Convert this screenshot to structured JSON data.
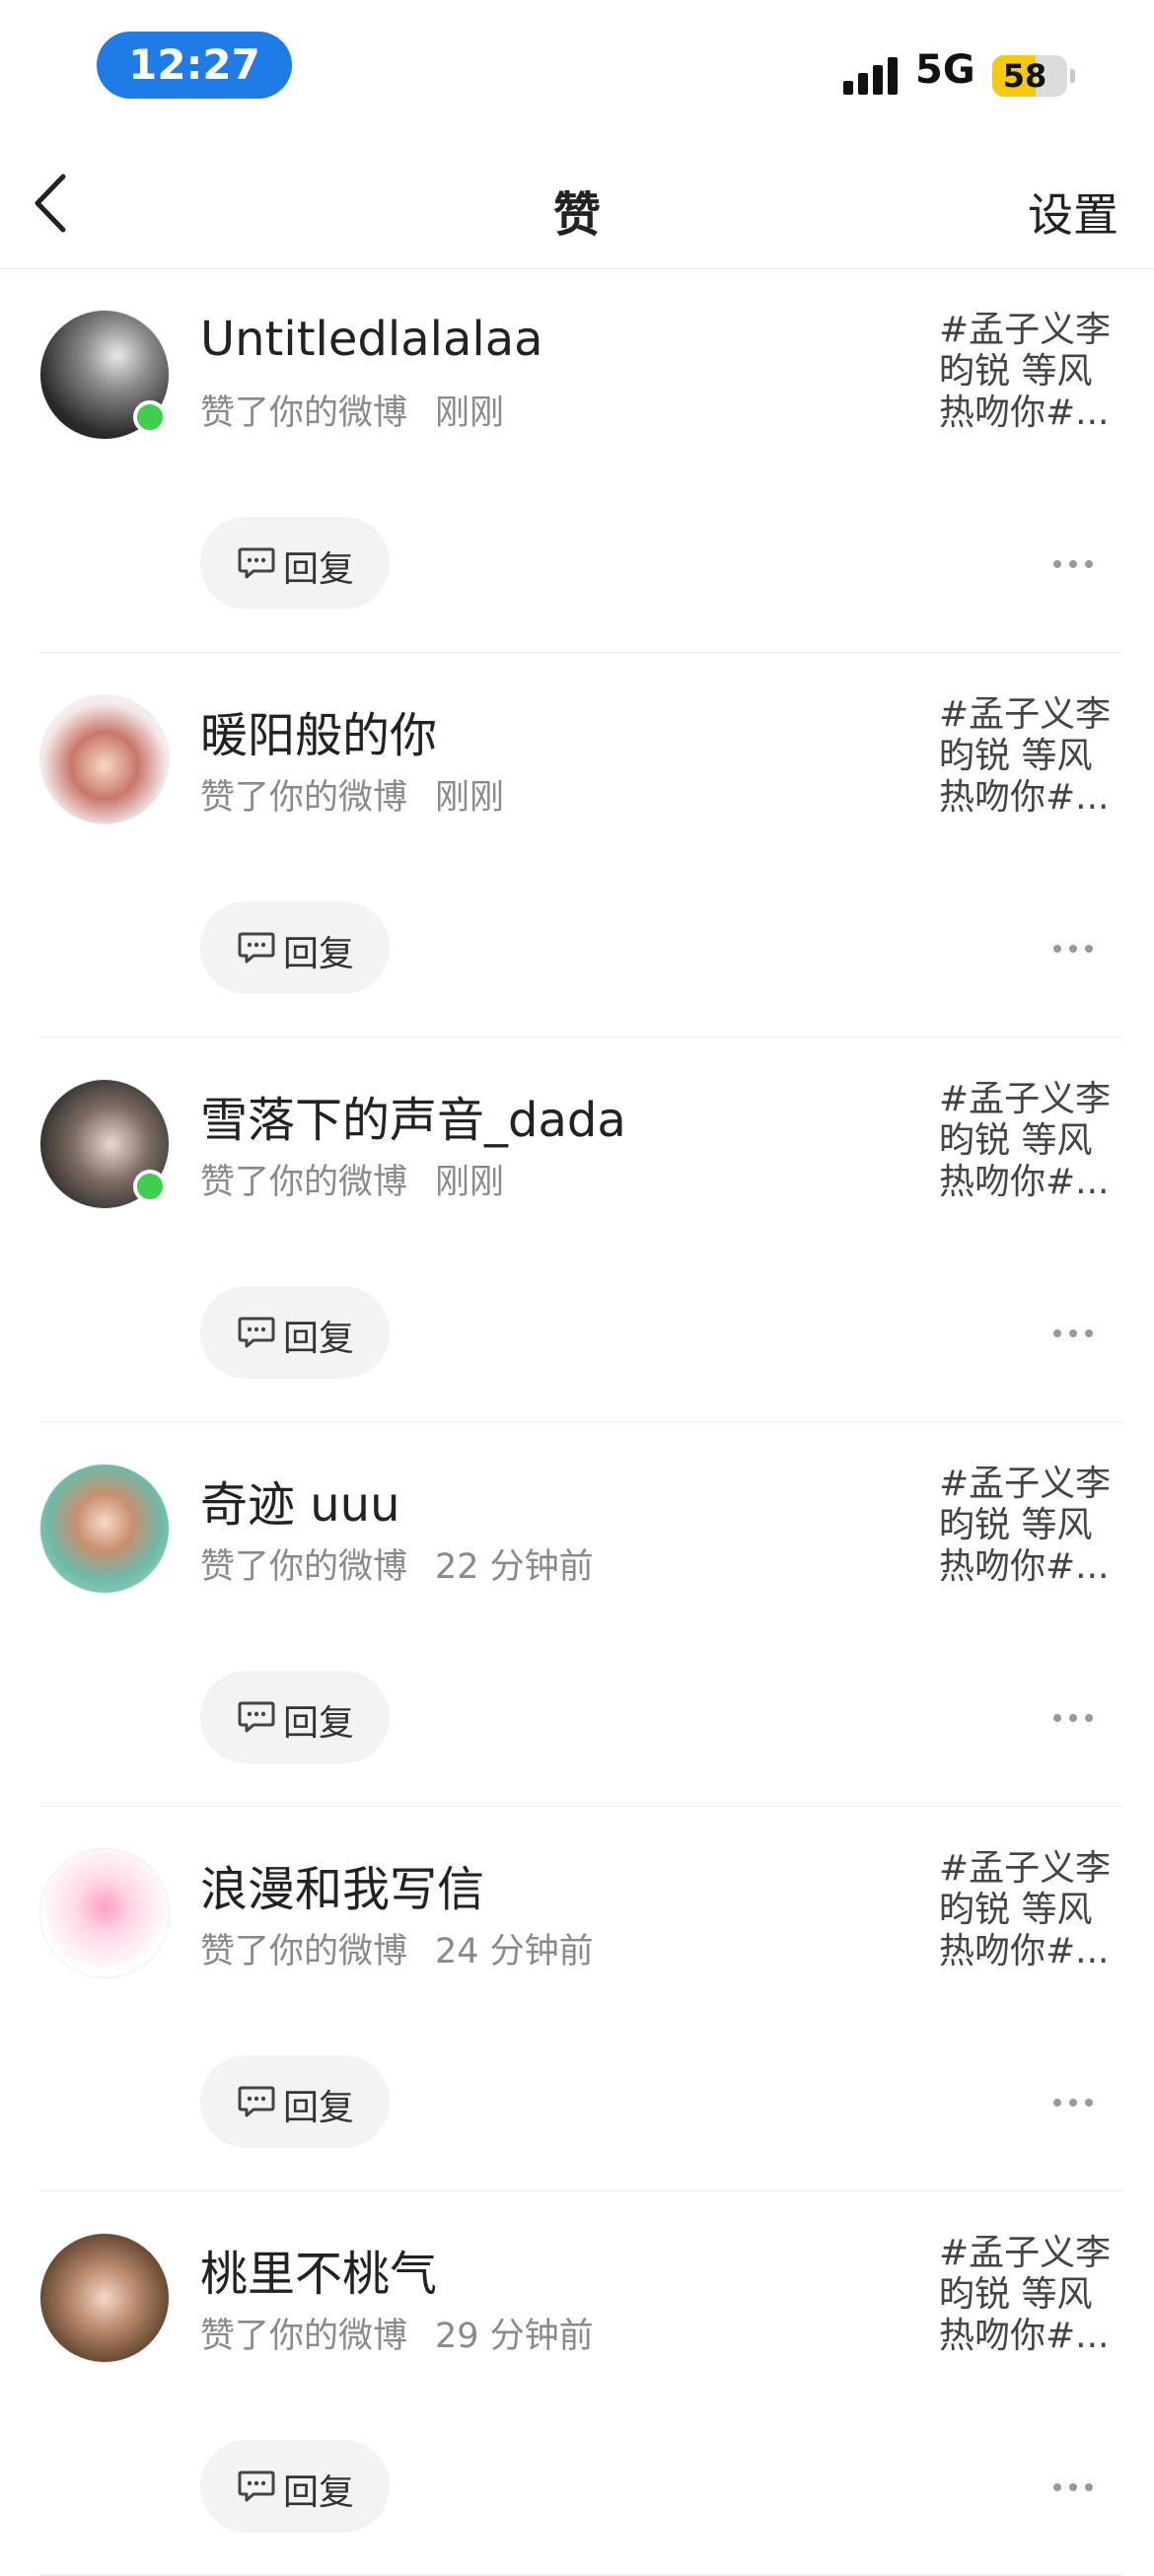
{
  "status_bar": {
    "time": "12:27",
    "network": "5G",
    "battery": "58",
    "battery_level": 0.58
  },
  "nav": {
    "back_icon": "chevron-left-icon",
    "title": "赞",
    "settings_label": "设置"
  },
  "reply_label": "回复",
  "items": [
    {
      "name": "Untitledlalalaa",
      "action": "赞了你的微博",
      "time": "刚刚",
      "online": true,
      "snippet": [
        "#孟子义李",
        "昀锐 等风",
        "热吻你#..."
      ]
    },
    {
      "name": "暖阳般的你",
      "action": "赞了你的微博",
      "time": "刚刚",
      "online": false,
      "snippet": [
        "#孟子义李",
        "昀锐 等风",
        "热吻你#..."
      ]
    },
    {
      "name": "雪落下的声音_dada",
      "action": "赞了你的微博",
      "time": "刚刚",
      "online": true,
      "snippet": [
        "#孟子义李",
        "昀锐 等风",
        "热吻你#..."
      ]
    },
    {
      "name": "奇迹 uuu",
      "action": "赞了你的微博",
      "time": "22 分钟前",
      "online": false,
      "snippet": [
        "#孟子义李",
        "昀锐 等风",
        "热吻你#..."
      ]
    },
    {
      "name": "浪漫和我写信",
      "action": "赞了你的微博",
      "time": "24 分钟前",
      "online": false,
      "snippet": [
        "#孟子义李",
        "昀锐 等风",
        "热吻你#..."
      ]
    },
    {
      "name": "桃里不桃气",
      "action": "赞了你的微博",
      "time": "29 分钟前",
      "online": false,
      "snippet": [
        "#孟子义李",
        "昀锐 等风",
        "热吻你#..."
      ]
    }
  ]
}
